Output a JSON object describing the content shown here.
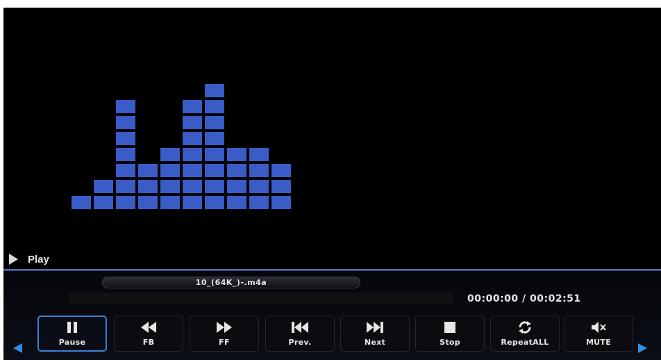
{
  "status": {
    "label": "Play",
    "icon": "play-icon"
  },
  "track": {
    "filename": "10_(64K_)-.m4a"
  },
  "progress": {
    "fraction": 0.0
  },
  "time": {
    "display": "00:00:00 / 00:02:51"
  },
  "controls": [
    {
      "label": "Pause",
      "icon": "pause-icon",
      "active": true
    },
    {
      "label": "FB",
      "icon": "fast-backward-icon"
    },
    {
      "label": "FF",
      "icon": "fast-forward-icon"
    },
    {
      "label": "Prev.",
      "icon": "previous-icon"
    },
    {
      "label": "Next",
      "icon": "next-icon"
    },
    {
      "label": "Stop",
      "icon": "stop-icon"
    },
    {
      "label": "RepeatALL",
      "icon": "repeat-icon"
    },
    {
      "label": "MUTE",
      "icon": "mute-icon"
    }
  ],
  "visualizer": {
    "levels": [
      1,
      2,
      7,
      3,
      4,
      7,
      8,
      4,
      4,
      3
    ],
    "max_level": 8,
    "color": "#3a5cc7"
  },
  "colors": {
    "accent": "#2d8fe6",
    "bars": "#3a5cc7",
    "progress": "#c9c9c9"
  }
}
